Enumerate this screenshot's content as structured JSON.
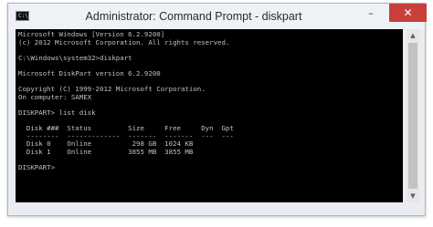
{
  "window": {
    "title": "Administrator: Command Prompt - diskpart",
    "icon": "cmd-icon",
    "icon_prompt": "C:\\",
    "controls": {
      "minimize": "–",
      "close": "✕"
    }
  },
  "console": {
    "lines": [
      "Microsoft Windows [Version 6.2.9200]",
      "(c) 2012 Microsoft Corporation. All rights reserved.",
      "",
      "C:\\Windows\\system32>diskpart",
      "",
      "Microsoft DiskPart version 6.2.9200",
      "",
      "Copyright (C) 1999-2012 Microsoft Corporation.",
      "On computer: SAMEX",
      "",
      "DISKPART> list disk",
      "",
      "  Disk ###  Status         Size     Free     Dyn  Gpt",
      "  --------  -------------  -------  -------  ---  ---",
      "  Disk 0    Online          298 GB  1024 KB",
      "  Disk 1    Online         3855 MB  3855 MB",
      "",
      "DISKPART> "
    ]
  },
  "scrollbar": {
    "up_arrow": "▲",
    "down_arrow": "▼"
  }
}
